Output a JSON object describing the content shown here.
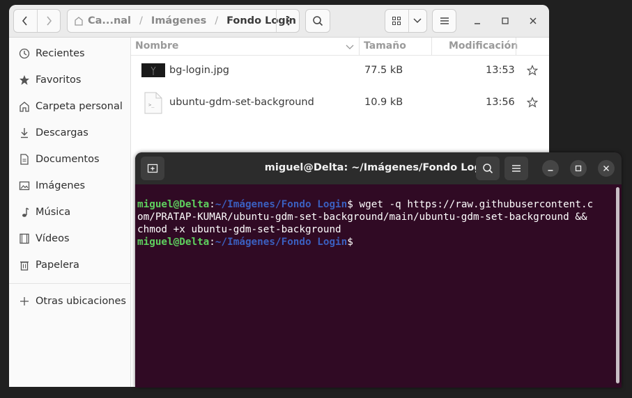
{
  "files": {
    "path": {
      "home": "Ca...nal",
      "sep1": "/",
      "parent": "Imágenes",
      "sep2": "/",
      "current": "Fondo Login"
    },
    "sidebar": [
      {
        "label": "Recientes",
        "icon": "clock-icon"
      },
      {
        "label": "Favoritos",
        "icon": "star-icon"
      },
      {
        "label": "Carpeta personal",
        "icon": "home-icon"
      },
      {
        "label": "Descargas",
        "icon": "download-icon"
      },
      {
        "label": "Documentos",
        "icon": "document-icon"
      },
      {
        "label": "Imágenes",
        "icon": "image-icon"
      },
      {
        "label": "Música",
        "icon": "music-icon"
      },
      {
        "label": "Vídeos",
        "icon": "video-icon"
      },
      {
        "label": "Papelera",
        "icon": "trash-icon"
      },
      {
        "label": "Otras ubicaciones",
        "icon": "plus-icon"
      }
    ],
    "columns": {
      "name": "Nombre",
      "size": "Tamaño",
      "modified": "Modificación"
    },
    "rows": [
      {
        "name": "bg-login.jpg",
        "size": "77.5 kB",
        "modified": "13:53",
        "icon": "image-thumbnail-icon"
      },
      {
        "name": "ubuntu-gdm-set-background",
        "size": "10.9 kB",
        "modified": "13:56",
        "icon": "script-file-icon"
      }
    ]
  },
  "terminal": {
    "title": "miguel@Delta: ~/Imágenes/Fondo Login",
    "lines": [
      {
        "user": "miguel@Delta",
        "colon": ":",
        "path": "~/Imágenes/Fondo Login",
        "prompt": "$",
        "cmd": " wget -q https://raw.githubusercontent.c"
      },
      {
        "text": "om/PRATAP-KUMAR/ubuntu-gdm-set-background/main/ubuntu-gdm-set-background &&"
      },
      {
        "text": "chmod +x ubuntu-gdm-set-background"
      },
      {
        "user": "miguel@Delta",
        "colon": ":",
        "path": "~/Imágenes/Fondo Login",
        "prompt": "$",
        "cmd": " "
      }
    ]
  },
  "colors": {
    "terminal_bg": "#300a24",
    "prompt_user": "#5ed05e",
    "prompt_path": "#3b5fbf"
  }
}
